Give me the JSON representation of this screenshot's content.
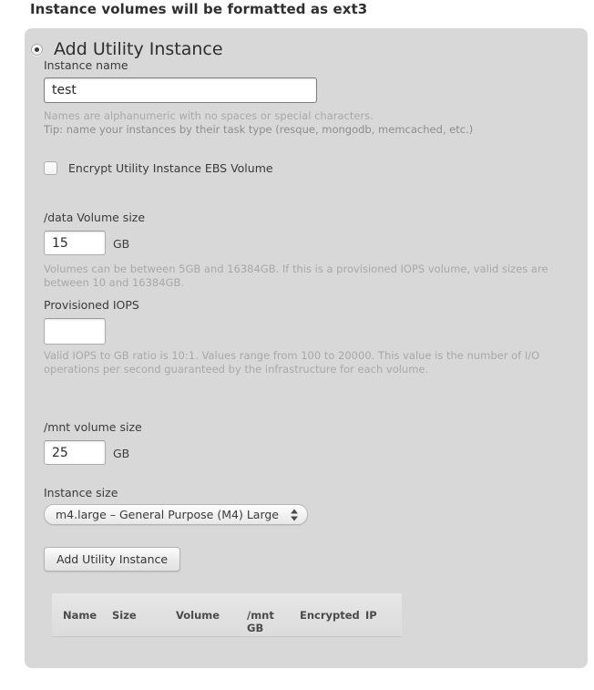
{
  "page": {
    "title": "Instance volumes will be formatted as ext3"
  },
  "panel": {
    "section_title": "Add Utility Instance",
    "radio_selected": true,
    "fields": {
      "instance_name": {
        "label": "Instance name",
        "value": "test",
        "placeholder": "",
        "help_line1": "Names are alphanumeric with no spaces or special characters.",
        "help_line2": "Tip: name your instances by their task type (resque, mongodb, memcached, etc.)"
      },
      "encrypt": {
        "label": "Encrypt Utility Instance EBS Volume",
        "checked": false
      },
      "data_volume": {
        "label": "/data Volume size",
        "value": "15",
        "unit": "GB",
        "help": "Volumes can be between 5GB and 16384GB. If this is a provisioned IOPS volume, valid sizes are between 10 and 16384GB."
      },
      "provisioned_iops": {
        "label": "Provisioned IOPS",
        "value": "",
        "placeholder": "",
        "help": "Valid IOPS to GB ratio is 10:1. Values range from 100 to 20000. This value is the number of I/O operations per second guaranteed by the infrastructure for each volume."
      },
      "mnt_volume": {
        "label": "/mnt volume size",
        "value": "25",
        "unit": "GB"
      },
      "instance_size": {
        "label": "Instance size",
        "selected": "m4.large – General Purpose (M4) Large"
      }
    },
    "submit_button": "Add Utility Instance",
    "table": {
      "columns": [
        "Name",
        "Size",
        "Volume",
        "/mnt\nGB",
        "Encrypted",
        "IP"
      ],
      "columns_display": {
        "name": "Name",
        "size": "Size",
        "volume": "Volume",
        "mnt_line1": "/mnt",
        "mnt_line2": "GB",
        "encrypted": "Encrypted",
        "ip": "IP"
      },
      "rows": []
    }
  },
  "colors": {
    "page_bg": "#ffffff",
    "panel_bg": "#d8d8d8",
    "text": "#3a3a3a",
    "help_text": "#a8a8a8",
    "input_bg": "#ffffff"
  }
}
